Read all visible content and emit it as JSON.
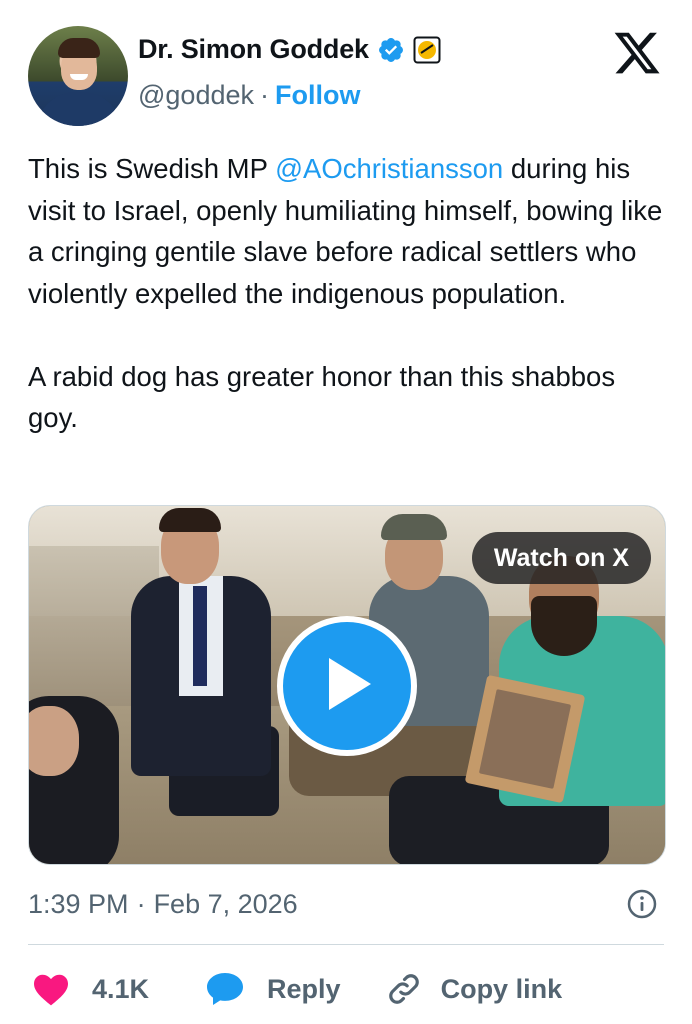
{
  "author": {
    "display_name": "Dr. Simon Goddek",
    "handle": "@goddek",
    "separator": "·",
    "follow_label": "Follow",
    "verified_icon": "verified-badge-icon",
    "affiliate_icon": "affiliate-badge-icon",
    "verified_color": "#1d9bf0"
  },
  "brand": {
    "logo": "x-logo-icon"
  },
  "tweet": {
    "paragraph1_before": "This is Swedish MP ",
    "mention": "@AOchristiansson",
    "paragraph1_after": " during his visit to Israel, openly humiliating himself, bowing like a cringing gentile slave before radical settlers who violently expelled the indigenous population.",
    "paragraph2": "A rabid dog has greater honor than this shabbos goy."
  },
  "media": {
    "watch_label": "Watch on X",
    "play_icon": "play-icon"
  },
  "meta": {
    "time": "1:39 PM",
    "separator": "·",
    "date": "Feb 7, 2026",
    "info_icon": "info-icon"
  },
  "actions": {
    "like_count": "4.1K",
    "reply_label": "Reply",
    "copy_label": "Copy link"
  },
  "colors": {
    "accent": "#1d9bf0",
    "like": "#f91880",
    "text": "#0f1419",
    "muted": "#536471"
  }
}
